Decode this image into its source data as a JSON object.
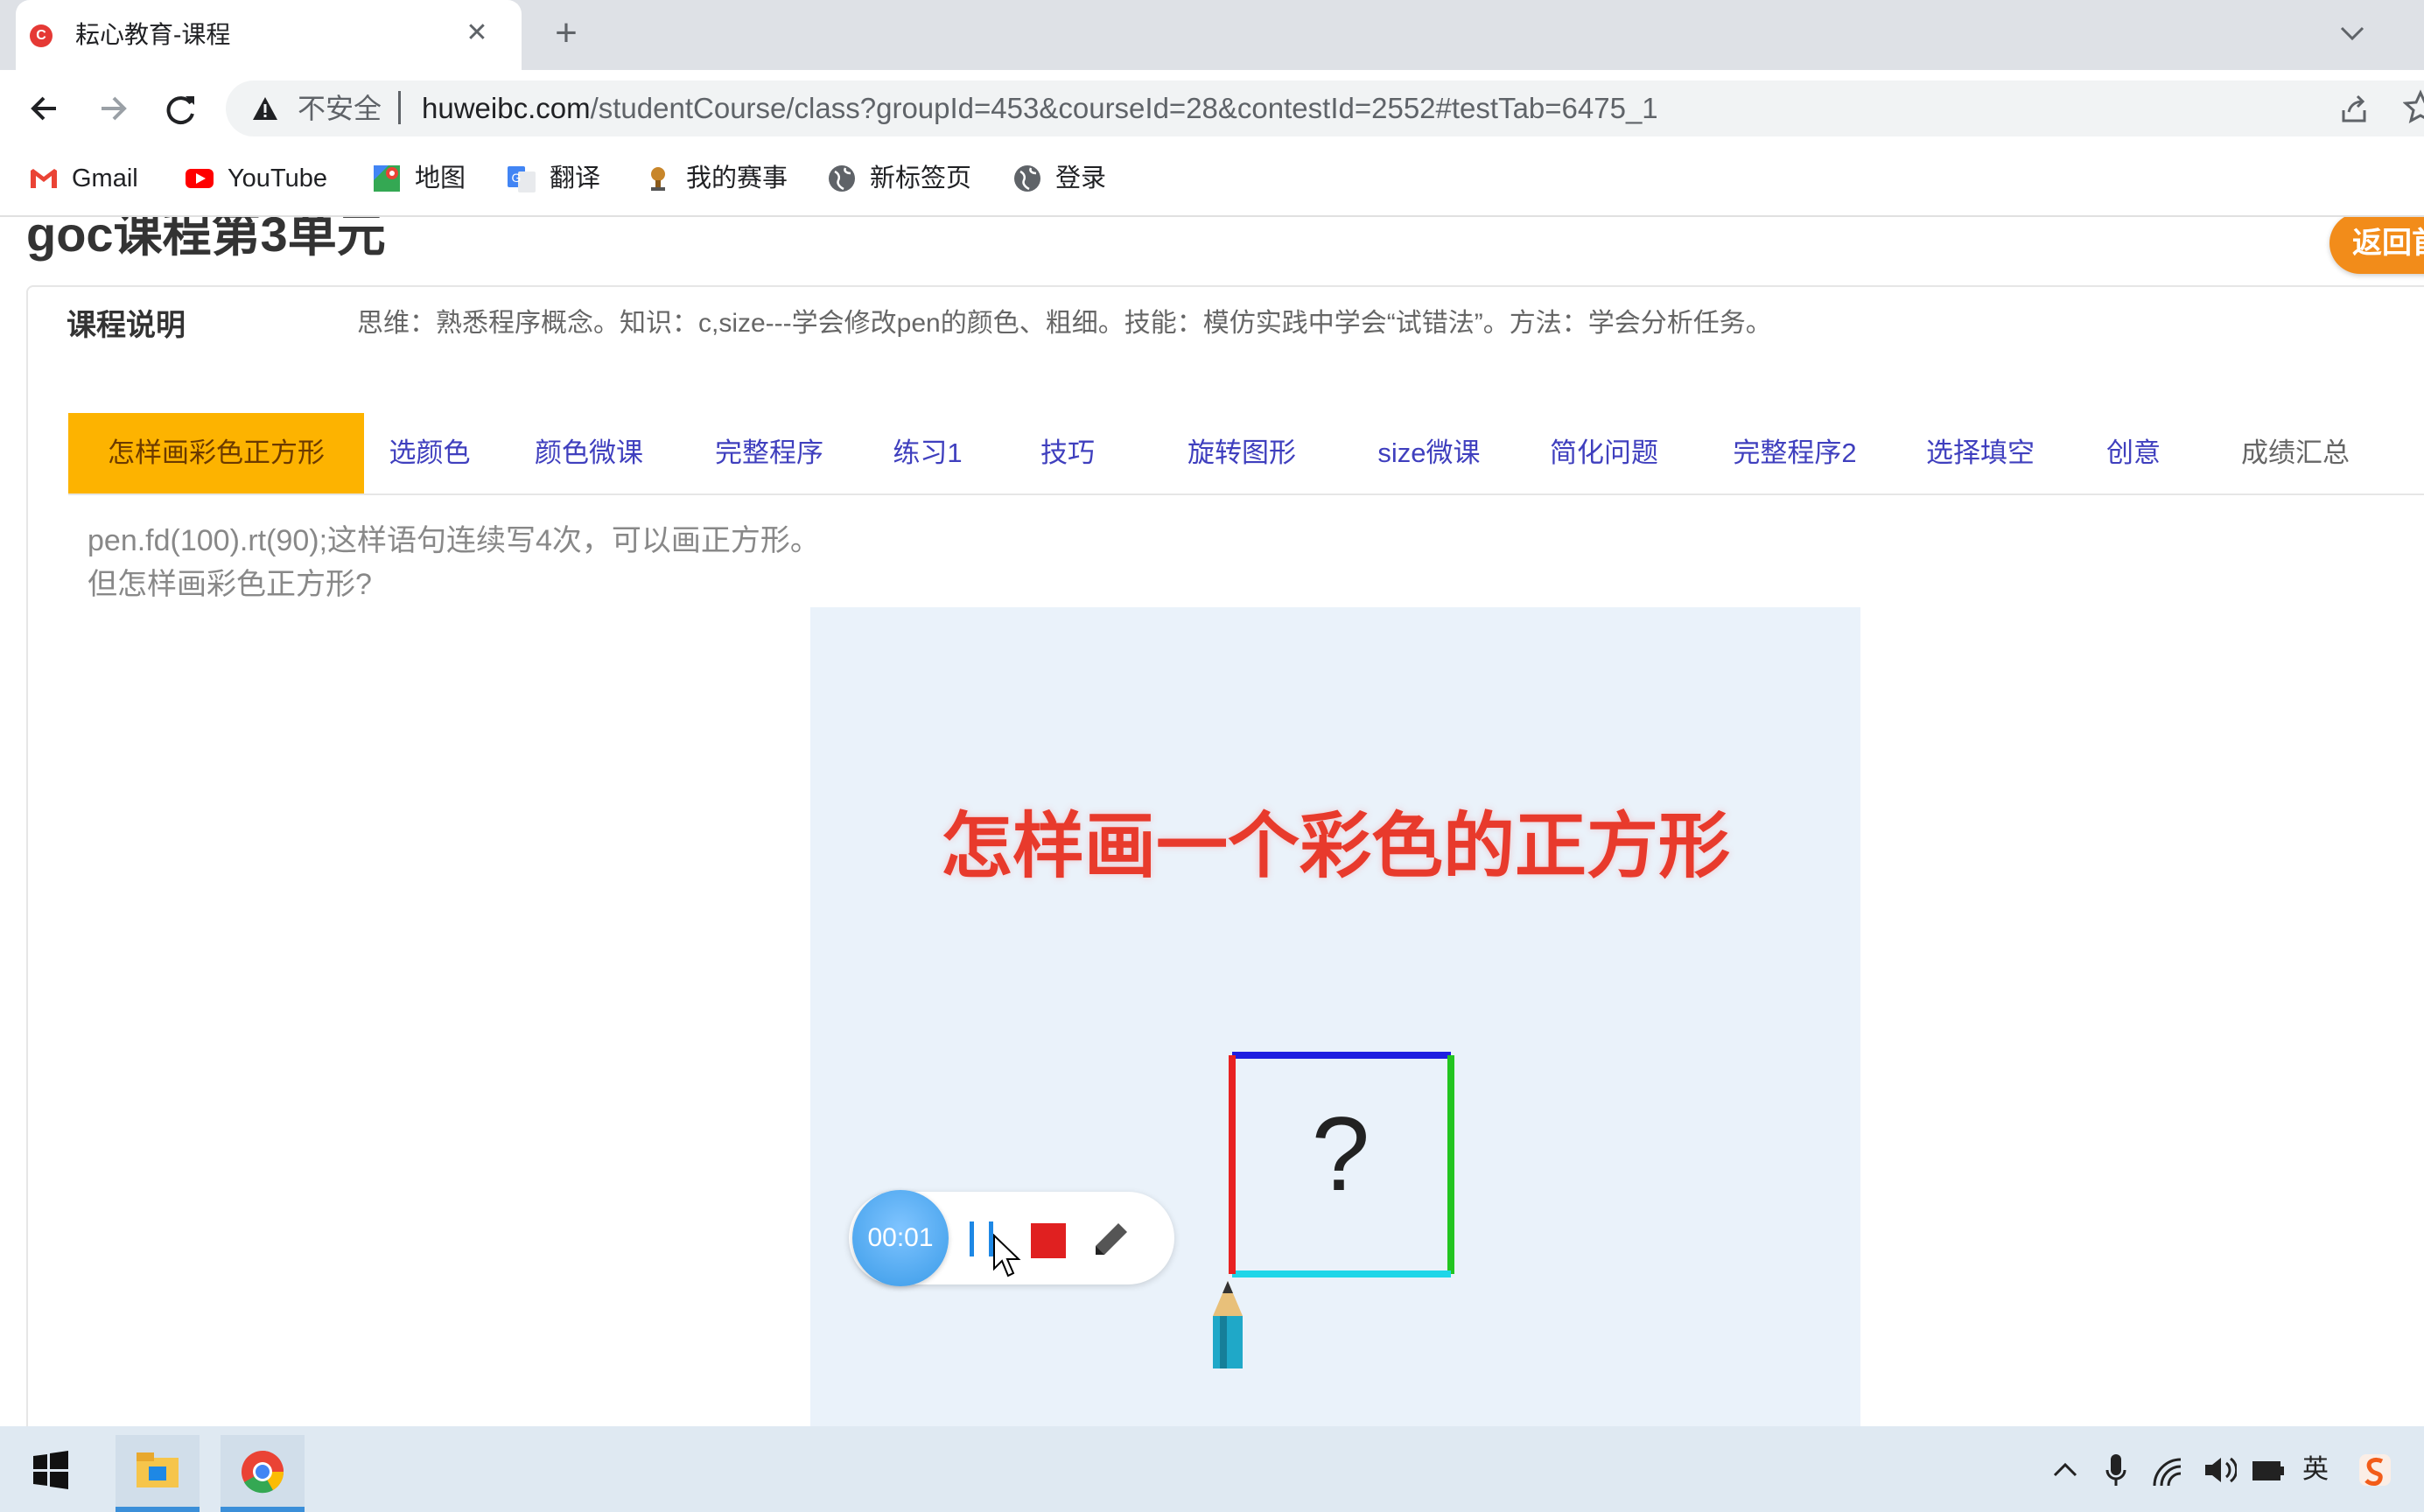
{
  "browser": {
    "tab_title": "耘心教育-课程",
    "tab_favicon_letter": "C",
    "new_tab_symbol": "+",
    "close_symbol": "✕",
    "insecure_label": "不安全",
    "url_host": "huweibc.com",
    "url_path": "/studentCourse/class?groupId=453&courseId=28&contestId=2552#testTab=6475_1"
  },
  "bookmarks": [
    {
      "label": "Gmail",
      "icon": "gmail-icon"
    },
    {
      "label": "YouTube",
      "icon": "youtube-icon"
    },
    {
      "label": "地图",
      "icon": "maps-icon"
    },
    {
      "label": "翻译",
      "icon": "translate-icon"
    },
    {
      "label": "我的赛事",
      "icon": "trophy-icon"
    },
    {
      "label": "新标签页",
      "icon": "globe-icon"
    },
    {
      "label": "登录",
      "icon": "globe-icon"
    }
  ],
  "page": {
    "title": "goc课程第3单元",
    "back_label": "返回首页",
    "description_label": "课程说明",
    "description_text": "思维：熟悉程序概念。知识：c,size---学会修改pen的颜色、粗细。技能：模仿实践中学会“试错法”。方法：学会分析任务。",
    "tabs": [
      "怎样画彩色正方形",
      "选颜色",
      "颜色微课",
      "完整程序",
      "练习1",
      "技巧",
      "旋转图形",
      "size微课",
      "简化问题",
      "完整程序2",
      "选择填空",
      "创意",
      "成绩汇总"
    ],
    "active_tab_index": 0,
    "question_line1": "pen.fd(100).rt(90);这样语句连续写4次，可以画正方形。",
    "question_line2": "但怎样画彩色正方形?",
    "video": {
      "title": "怎样画一个彩色的正方形",
      "question_mark": "?",
      "square_colors": {
        "top": "#1f1fe0",
        "right": "#22c51f",
        "bottom": "#1fd6e8",
        "left": "#e82222"
      }
    }
  },
  "recorder": {
    "timer": "00:01",
    "stop_color": "#e02020"
  },
  "taskbar": {
    "ime_label": "英",
    "tray_icons": [
      "chevron-up-icon",
      "microphone-icon",
      "wifi-icon",
      "volume-icon",
      "battery-icon",
      "ime-icon",
      "sogou-icon"
    ]
  }
}
